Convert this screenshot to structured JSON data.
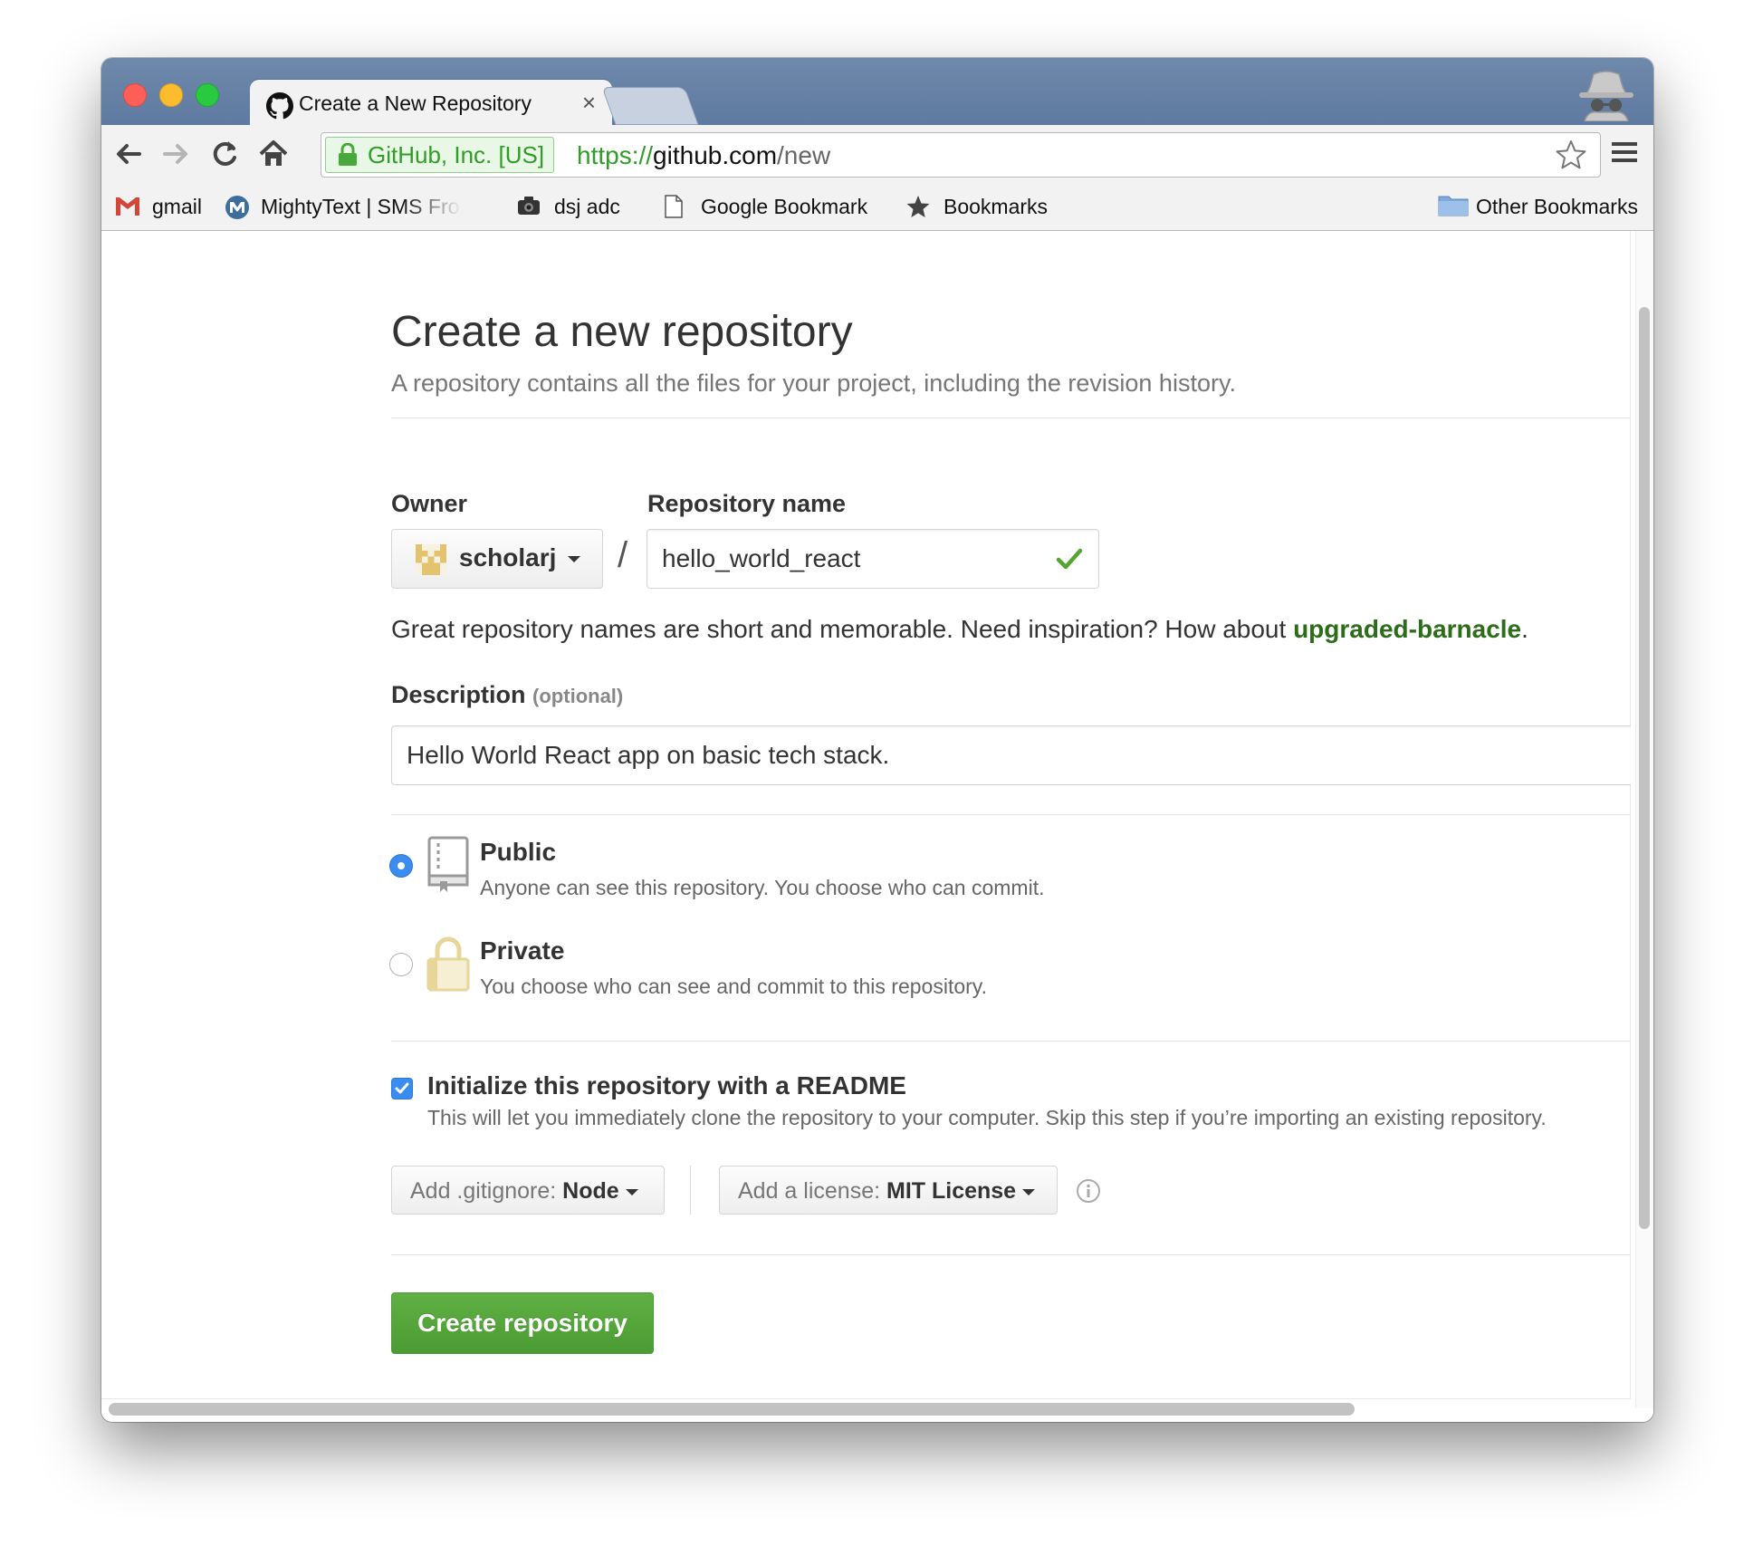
{
  "browser": {
    "tab_title": "Create a New Repository",
    "tab_close": "×",
    "ev_label": "GitHub, Inc. [US]",
    "url_scheme": "https://",
    "url_host": "github.com",
    "url_path": "/new",
    "bookmarks": [
      {
        "label": "gmail",
        "icon": "gmail-icon"
      },
      {
        "label": "MightyText | SMS Fro",
        "icon": "mightytext-icon"
      },
      {
        "label": "dsj adc",
        "icon": "camera-icon"
      },
      {
        "label": "Google Bookmark",
        "icon": "page-icon"
      },
      {
        "label": "Bookmarks",
        "icon": "star-icon"
      }
    ],
    "other_bookmarks": "Other Bookmarks"
  },
  "page": {
    "title": "Create a new repository",
    "subtitle": "A repository contains all the files for your project, including the revision history.",
    "owner_label": "Owner",
    "repo_label": "Repository name",
    "owner_value": "scholarj",
    "slash": "/",
    "repo_value": "hello_world_react",
    "hint_prefix": "Great repository names are short and memorable. Need inspiration? How about ",
    "hint_suggestion": "upgraded-barnacle",
    "hint_suffix": ".",
    "description_label": "Description",
    "description_optional": "(optional)",
    "description_value": "Hello World React app on basic tech stack.",
    "visibility": [
      {
        "title": "Public",
        "desc": "Anyone can see this repository. You choose who can commit.",
        "selected": true
      },
      {
        "title": "Private",
        "desc": "You choose who can see and commit to this repository.",
        "selected": false
      }
    ],
    "init_readme_title": "Initialize this repository with a README",
    "init_readme_desc": "This will let you immediately clone the repository to your computer. Skip this step if you’re importing an existing repository.",
    "init_readme_checked": true,
    "gitignore_prefix": "Add .gitignore:",
    "gitignore_value": "Node",
    "license_prefix": "Add a license:",
    "license_value": "MIT License",
    "create_button": "Create repository"
  },
  "colors": {
    "accent_blue": "#3b8cf0",
    "create_green": "#55a532",
    "suggestion_green": "#2c6d19",
    "secure_green": "#2f9d27"
  }
}
